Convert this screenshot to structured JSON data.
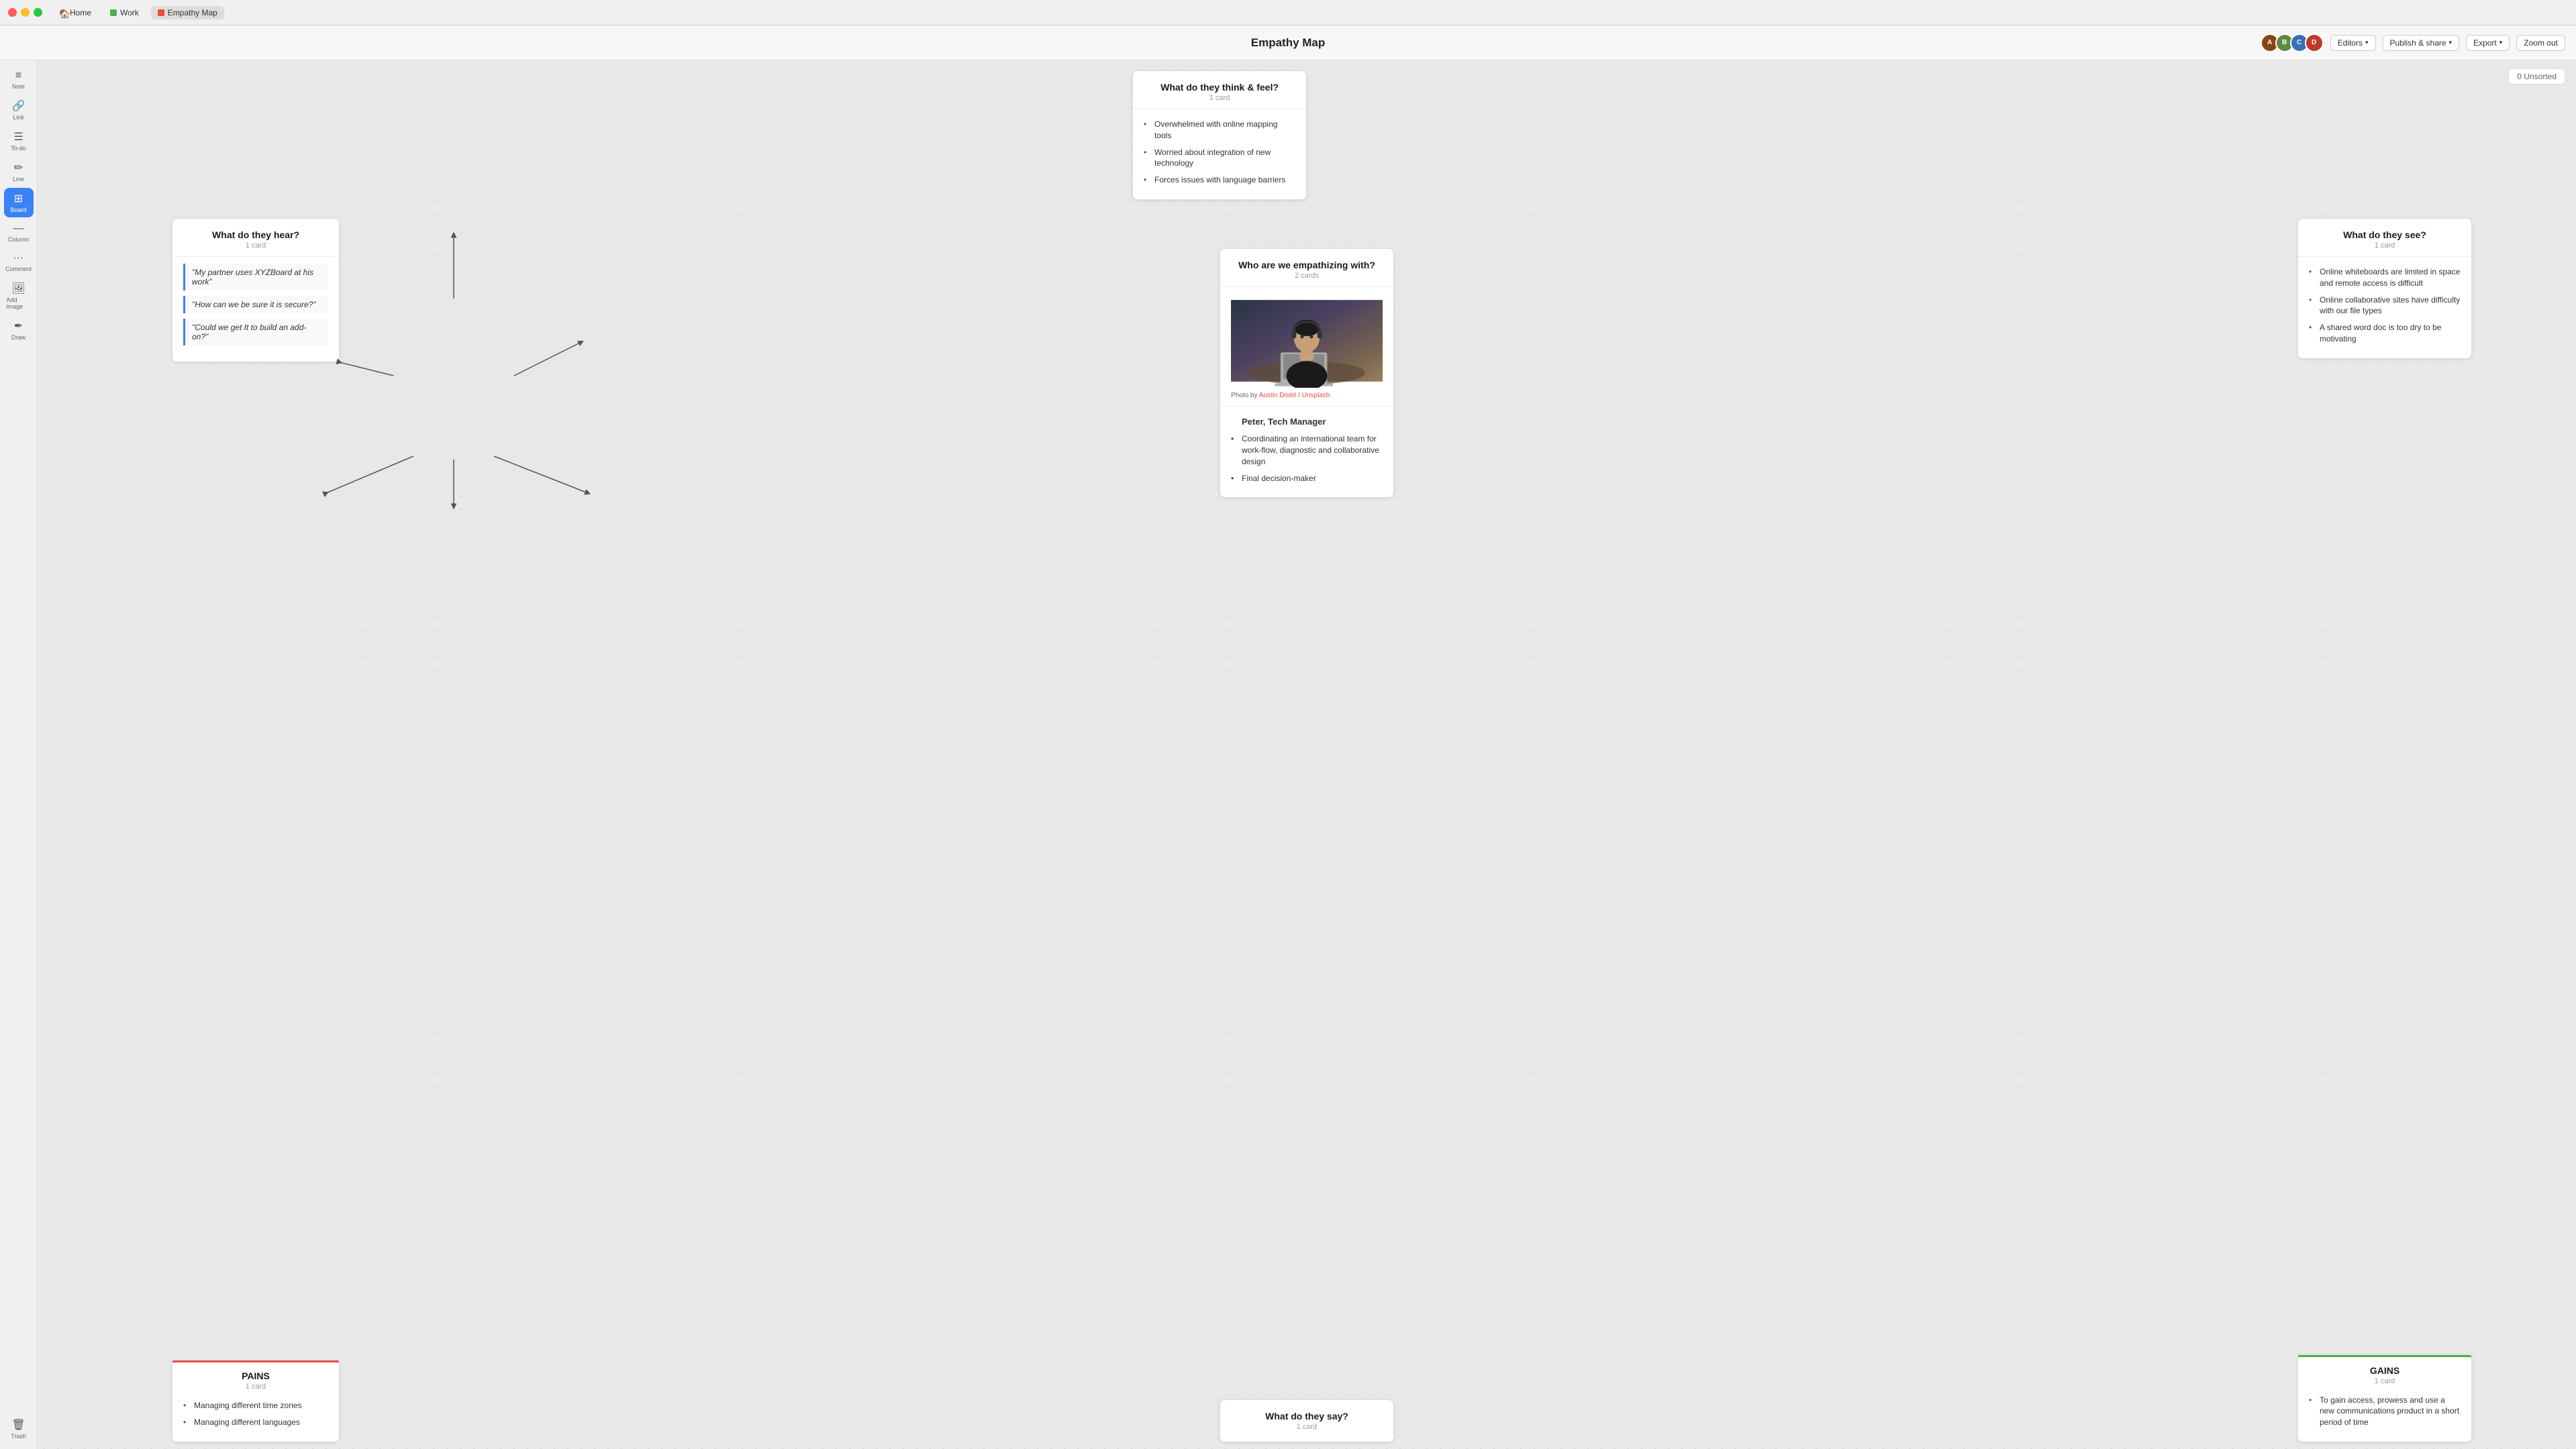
{
  "titlebar": {
    "traffic": [
      "red",
      "yellow",
      "green"
    ],
    "tabs": [
      {
        "label": "Home",
        "type": "home"
      },
      {
        "label": "Work",
        "type": "work"
      },
      {
        "label": "Empathy Map",
        "type": "empathy"
      }
    ]
  },
  "header": {
    "title": "Empathy Map",
    "editors_label": "Editors",
    "publish_label": "Publish & share",
    "export_label": "Export",
    "zoom_label": "Zoom out"
  },
  "sidebar": {
    "items": [
      {
        "id": "note",
        "icon": "≡",
        "label": "Note"
      },
      {
        "id": "link",
        "icon": "🔗",
        "label": "Link"
      },
      {
        "id": "todo",
        "icon": "☰",
        "label": "To-do"
      },
      {
        "id": "line",
        "icon": "✏",
        "label": "Line"
      },
      {
        "id": "board",
        "icon": "⊞",
        "label": "Board"
      },
      {
        "id": "column",
        "icon": "—",
        "label": "Column"
      },
      {
        "id": "comment",
        "icon": "···",
        "label": "Comment"
      },
      {
        "id": "image",
        "icon": "🖼",
        "label": "Add image"
      },
      {
        "id": "draw",
        "icon": "✒",
        "label": "Draw"
      }
    ],
    "trash_label": "Trash"
  },
  "unsorted": "0 Unsorted",
  "cards": {
    "think_feel": {
      "title": "What do they think & feel?",
      "count": "1 card",
      "bullets": [
        "Overwhelmed with online mapping tools",
        "Worried about integration of new technology",
        "Forces issues with language barriers"
      ]
    },
    "who": {
      "title": "Who are we empathizing with?",
      "count": "2 cards",
      "photo_credit_prefix": "Photo by ",
      "photo_author": "Austin Distel",
      "photo_separator": " / ",
      "photo_source": "Unsplash",
      "person_name": "Peter, Tech Manager",
      "person_bullets": [
        "Coordinating an international team for work-flow, diagnostic and collaborative design",
        "Final decision-maker"
      ]
    },
    "hear": {
      "title": "What do they hear?",
      "count": "1 card",
      "quotes": [
        "\"My partner uses XYZBoard at his work\"",
        "\"How can we be sure it is secure?\"",
        "\"Could we get It to build an add-on?\""
      ]
    },
    "see": {
      "title": "What do they see?",
      "count": "1 card",
      "bullets": [
        "Online whiteboards are limited in space and remote access is difficult",
        "Online collaborative sites have difficulty with our file types",
        "A shared word doc is too dry to be motivating"
      ]
    },
    "pains": {
      "title": "PAINS",
      "count": "1 card",
      "bullets": [
        "Managing different time zones",
        "Managing different languages"
      ]
    },
    "gains": {
      "title": "GAINS",
      "count": "1 card",
      "bullets": [
        "To gain access, prowess and use a new communications product in a short period of time"
      ]
    },
    "say": {
      "title": "What do they say?",
      "count": "1 card"
    }
  }
}
